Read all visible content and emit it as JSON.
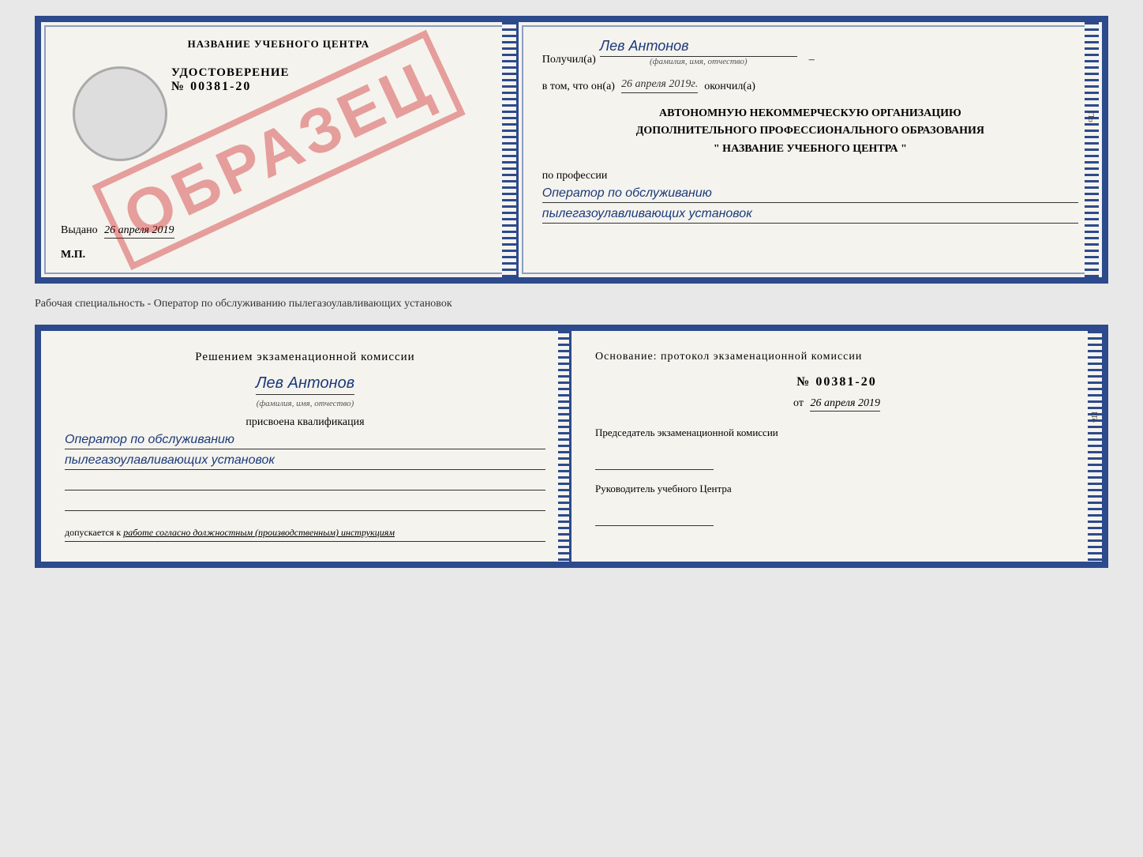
{
  "topCert": {
    "left": {
      "schoolName": "НАЗВАНИЕ УЧЕБНОГО ЦЕНТРА",
      "certLabel": "УДОСТОВЕРЕНИЕ",
      "certNumber": "№ 00381-20",
      "vydano": "Выдано",
      "vydanoDate": "26 апреля 2019",
      "mp": "М.П.",
      "obrazec": "ОБРАЗЕЦ"
    },
    "right": {
      "poluchilLabel": "Получил(а)",
      "poluchilName": "Лев Антонов",
      "fioLabel": "(фамилия, имя, отчество)",
      "vtomLabel": "в том, что он(а)",
      "vtomDate": "26 апреля 2019г.",
      "okonchilLabel": "окончил(а)",
      "orgLine1": "АВТОНОМНУЮ НЕКОММЕРЧЕСКУЮ ОРГАНИЗАЦИЮ",
      "orgLine2": "ДОПОЛНИТЕЛЬНОГО ПРОФЕССИОНАЛЬНОГО ОБРАЗОВАНИЯ",
      "orgLine3": "\"   НАЗВАНИЕ УЧЕБНОГО ЦЕНТРА   \"",
      "professiaLabel": "по профессии",
      "professiaLine1": "Оператор по обслуживанию",
      "professiaLine2": "пылегазоулавливающих установок"
    }
  },
  "middleText": "Рабочая специальность - Оператор по обслуживанию пылегазоулавливающих установок",
  "bottomCert": {
    "left": {
      "resheniyeTitle": "Решением экзаменационной комиссии",
      "personName": "Лев Антонов",
      "fioLabel": "(фамилия, имя, отчество)",
      "prisvoyenaLabel": "присвоена квалификация",
      "kvalLine1": "Оператор по обслуживанию",
      "kvalLine2": "пылегазоулавливающих установок",
      "dopuskaetsia": "допускается к",
      "dopuskaetsiaValue": "работе согласно должностным (производственным) инструкциям"
    },
    "right": {
      "osnovanie": "Основание: протокол экзаменационной комиссии",
      "protocolNumber": "№  00381-20",
      "otLabel": "от",
      "otDate": "26 апреля 2019",
      "predsedatelLabel": "Председатель экзаменационной комиссии",
      "rukovoditelLabel": "Руководитель учебного Центра"
    }
  },
  "sideTexts": {
    "ito": "ITo"
  }
}
